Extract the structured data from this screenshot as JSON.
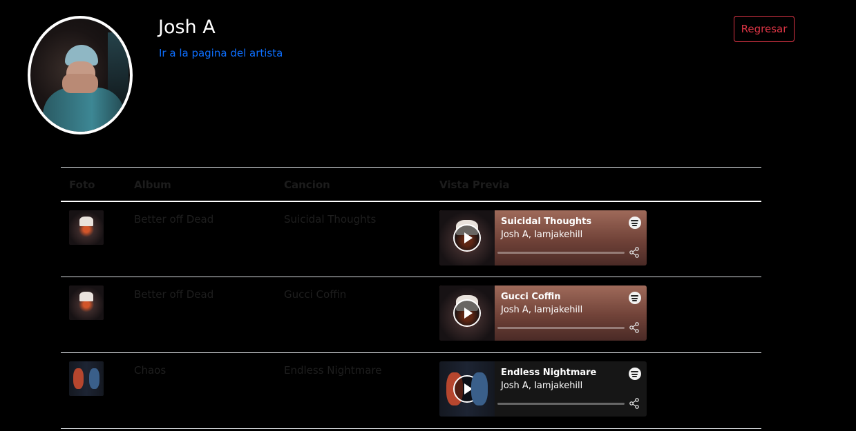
{
  "artist": {
    "name": "Josh A",
    "link_label": "Ir a la pagina del artista"
  },
  "back_button": "Regresar",
  "table": {
    "headers": [
      "Foto",
      "Album",
      "Cancion",
      "Vista Previa"
    ],
    "rows": [
      {
        "album": "Better off Dead",
        "song": "Suicidal Thoughts",
        "preview": {
          "title": "Suicidal Thoughts",
          "artists": "Josh A, Iamjakehill"
        }
      },
      {
        "album": "Better off Dead",
        "song": "Gucci Coffin",
        "preview": {
          "title": "Gucci Coffin",
          "artists": "Josh A, Iamjakehill"
        }
      },
      {
        "album": "Chaos",
        "song": "Endless Nightmare",
        "preview": {
          "title": "Endless Nightmare",
          "artists": "Josh A, Iamjakehill"
        }
      }
    ]
  },
  "colors": {
    "background": "#000000",
    "link": "#0d6efd",
    "danger": "#dc3545",
    "muted_text": "#1e1e1e"
  },
  "icons": [
    "play-icon",
    "spotify-icon",
    "share-icon"
  ]
}
